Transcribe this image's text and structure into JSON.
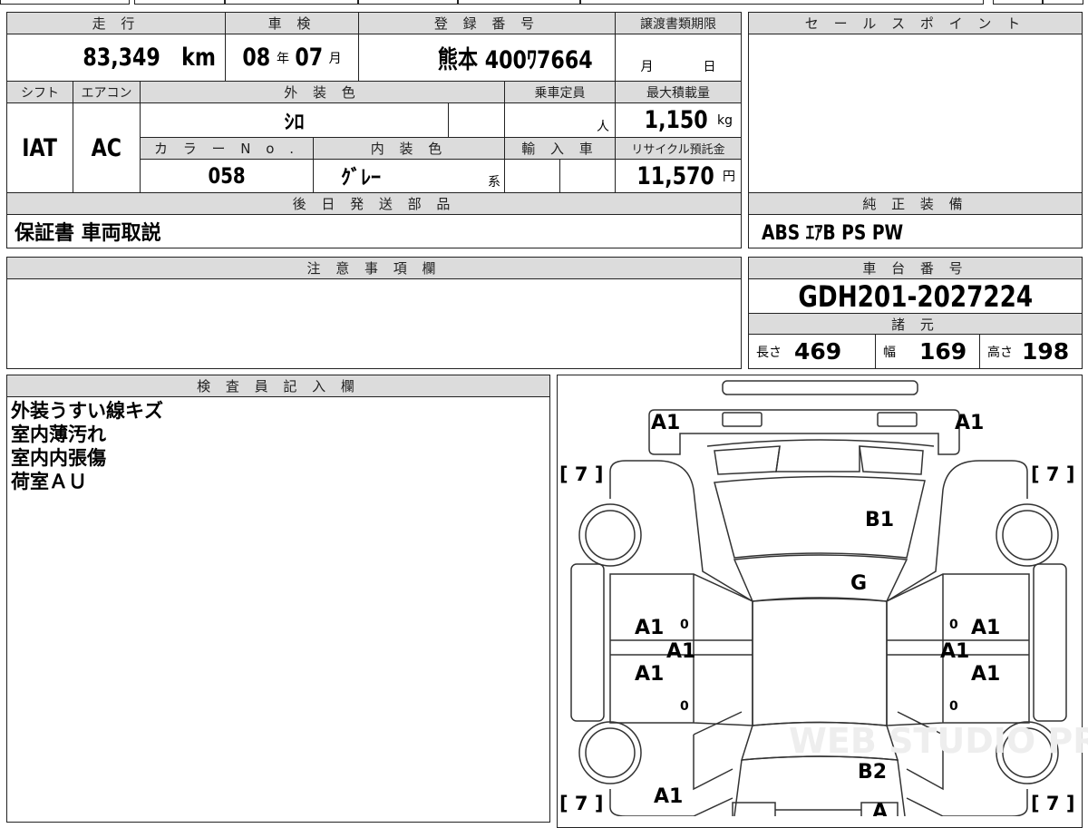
{
  "main_table": {
    "headers": {
      "mileage": "走 行",
      "inspection": "車 検",
      "registration": "登 録 番 号",
      "transfer_deadline": "譲渡書類期限",
      "shift": "シフト",
      "aircon": "エアコン",
      "exterior_color": "外 装 色",
      "capacity": "乗車定員",
      "max_load": "最大積載量",
      "color_no": "カ ラ ー N o .",
      "interior_color": "内 装 色",
      "imported": "輸 入 車",
      "recycle_fee": "リサイクル預託金",
      "later_parts": "後 日 発 送 部 品"
    },
    "values": {
      "mileage": "83,349",
      "mileage_unit": "km",
      "inspection_year": "08",
      "year_unit": "年",
      "inspection_month": "07",
      "month_unit": "月",
      "registration": "熊本 400ﾜ7664",
      "deadline_month_unit": "月",
      "deadline_day_unit": "日",
      "shift": "IAT",
      "aircon": "AC",
      "exterior_color": "ｼﾛ",
      "capacity_unit": "人",
      "max_load": "1,150",
      "max_load_unit": "kg",
      "color_no": "058",
      "interior_color": "ｸﾞﾚｰ",
      "interior_suffix": "系",
      "recycle_fee": "11,570",
      "recycle_unit": "円",
      "later_parts": "保証書 車両取説"
    }
  },
  "sales_point": {
    "header": "セ ー ル ス ポ イ ン ト",
    "body": ""
  },
  "equipment": {
    "header": "純 正 装 備",
    "value": "ABS ｴｱB PS PW"
  },
  "caution": {
    "header": "注 意 事 項 欄",
    "body": ""
  },
  "chassis": {
    "header": "車 台 番 号",
    "value": "GDH201-2027224",
    "specs_header": "諸 元",
    "length_label": "長さ",
    "length": "469",
    "width_label": "幅",
    "width": "169",
    "height_label": "高さ",
    "height": "198"
  },
  "inspector": {
    "header": "検 査 員 記 入 欄",
    "notes": [
      "外装うすい線キズ",
      "室内薄汚れ",
      "室内内張傷",
      "荷室ＡＵ"
    ]
  },
  "diagram": {
    "marks": {
      "rear_left": "A1",
      "rear_right": "A1",
      "hood": "B1",
      "windshield": "G",
      "left_front_door": "A1",
      "left_pillar": "A1",
      "left_rear_door": "A1",
      "right_front_door": "A1",
      "right_pillar": "A1",
      "right_rear_door": "A1",
      "trunk": "B2",
      "front_left": "A1",
      "front_bumper": "A"
    },
    "tires": [
      "[ 7 ]",
      "[ 7 ]",
      "[ 7 ]",
      "[ 7 ]"
    ],
    "door_small": "0",
    "watermark": "WEB STUDIO PRO"
  }
}
